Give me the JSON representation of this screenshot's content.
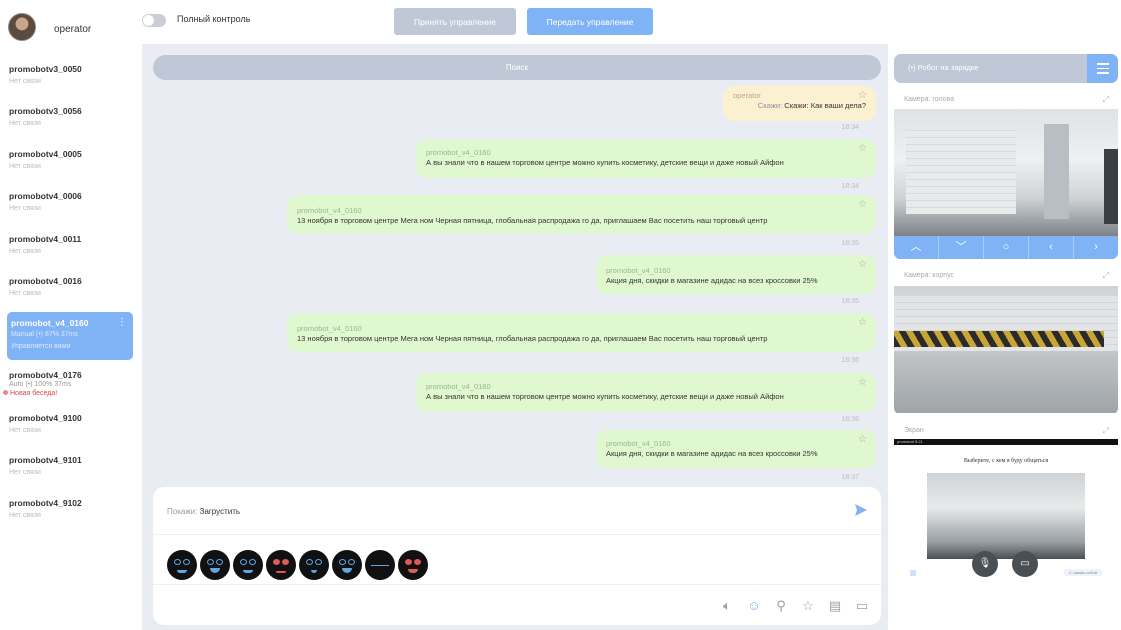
{
  "user": {
    "name": "operator"
  },
  "topbar": {
    "toggle_label": "Полный контроль",
    "accept_label": "Принять управление",
    "transfer_label": "Передать управление"
  },
  "robots": [
    {
      "name": "promobotv3_0050",
      "status": "Нет связи"
    },
    {
      "name": "promobotv3_0056",
      "status": "Нет связи"
    },
    {
      "name": "promobotv4_0005",
      "status": "Нет связи"
    },
    {
      "name": "promobotv4_0006",
      "status": "Нет связи"
    },
    {
      "name": "promobotv4_0011",
      "status": "Нет связи"
    },
    {
      "name": "promobotv4_0016",
      "status": "Нет связи"
    },
    {
      "name": "promobot_v4_0160",
      "status": "Manual  (•) 87%  37ms",
      "status2": "Управляется вами",
      "active": true
    },
    {
      "name": "promobotv4_0176",
      "status": "Auto  (•) 100%  37ms",
      "alert": "Новая беседа!"
    },
    {
      "name": "promobotv4_9100",
      "status": "Нет связи"
    },
    {
      "name": "promobotv4_9101",
      "status": "Нет связи"
    },
    {
      "name": "promobotv4_9102",
      "status": "Нет связи"
    }
  ],
  "search": {
    "placeholder": "Поиск"
  },
  "messages": [
    {
      "author": "operator",
      "kw": "Скажи:",
      "text": "Скажи: Как ваши дела?",
      "time": "18:34",
      "type": "operator"
    },
    {
      "author": "promobot_v4_0160",
      "text": "А вы знали что в нашем торговом центре можно купить косметику, детские вещи и даже новый Айфон",
      "time": "18:34"
    },
    {
      "author": "promobot_v4_0160",
      "text": "13 ноября в торговом центре Мега ном Черная пятница, глобальная распродажа го да, приглашаем Вас посетить наш торговый центр",
      "time": "18:35"
    },
    {
      "author": "promobot_v4_0160",
      "text": "Акция дня, скидки в магазине адидас на всез кроссовки 25%",
      "time": "18:35"
    },
    {
      "author": "promobot_v4_0160",
      "text": "13 ноября в торговом центре Мега ном Черная пятница, глобальная распродажа го да, приглашаем Вас посетить наш торговый центр",
      "time": "18:36"
    },
    {
      "author": "promobot_v4_0160",
      "text": "А вы знали что в нашем торговом центре можно купить косметику, детские вещи и даже новый Айфон",
      "time": "18:36"
    },
    {
      "author": "promobot_v4_0160",
      "text": "Акция дня, скидки в магазине адидас на всез кроссовки 25%",
      "time": "18:37"
    }
  ],
  "input": {
    "kw": "Покажи:",
    "value": "Загрустить"
  },
  "right": {
    "header": "(•)  Робот на зарядке",
    "cam1_title": "Камера: голова",
    "cam2_title": "Камера: корпус",
    "screen_title": "Экран",
    "screen_prompt": "Выберите, с кем я буду общаться",
    "screen_status": "promobot  5:21",
    "screen_footer": "С самим собой"
  },
  "icons": {
    "send": "send-icon",
    "toolbar": [
      "speaker-icon",
      "smile-icon",
      "person-icon",
      "star-icon",
      "trash-icon",
      "monitor-icon"
    ],
    "cam_controls": [
      "chevron-up-icon",
      "chevron-down-icon",
      "circle-icon",
      "chevron-left-icon",
      "chevron-right-icon"
    ]
  },
  "colors": {
    "accent": "#7fb3f5",
    "muted": "#c0c8d8",
    "robot_bubble": "#dff8cf",
    "operator_bubble": "#fbf0cf",
    "alert": "#e04646"
  }
}
